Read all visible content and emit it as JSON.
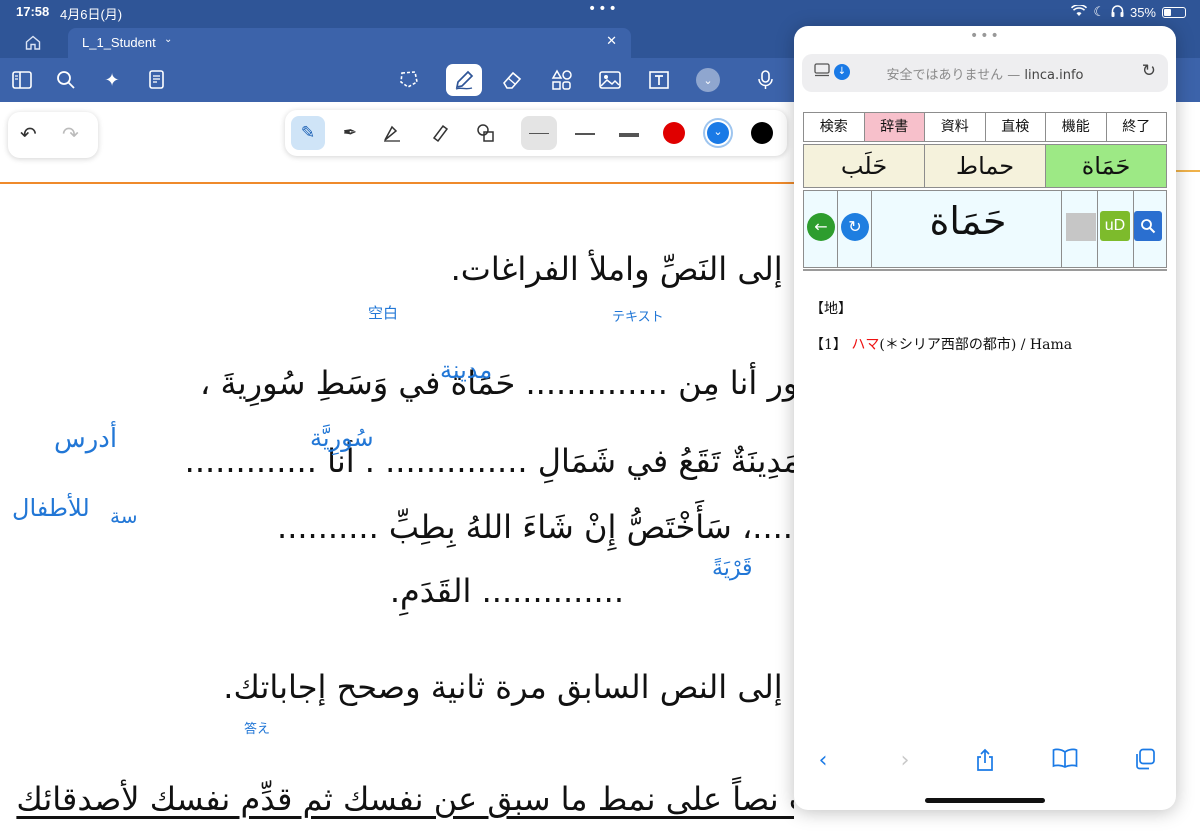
{
  "status": {
    "time": "17:58",
    "date": "4月6日(月)",
    "battery": "35%",
    "battery_level": 0.35,
    "center_dots": "•••",
    "wifi_icon": "wifi-icon",
    "moon_icon": "moon-icon",
    "headphones_icon": "headphones-icon"
  },
  "tabs": {
    "home_icon": "⌂",
    "active_tab": "L_1_Student",
    "tab_chevron": "⌄",
    "close": "✕"
  },
  "toolbar": {
    "icons": [
      "sidebar-icon",
      "search-icon",
      "sparkle-icon",
      "document-icon",
      "lasso-icon",
      "pen-icon",
      "eraser-icon",
      "shapes-icon",
      "image-icon",
      "textbox-icon",
      "more-chevron-icon",
      "microphone-icon"
    ]
  },
  "pen_options": {
    "colors": [
      "#e00000",
      "#1a7ae6",
      "#000000"
    ],
    "selected_color": "#1a7ae6"
  },
  "document": {
    "lines": [
      "ارجع إلى النَصِّ واملأ الفراغات.",
      "منصور أنا مِن .............. حَمَاة في وَسَطِ سُورِيةَ ،",
      "هي مَدِينَةٌ تَقَعُ في شَمَالِ .............. . أنا .............",
      "..........، سَأَخْتَصُّ إِنْ شَاءَ اللهُ بِطِبِّ ..........",
      ".............. القَدَمِ.",
      "ارجع إلى النص السابق مرة ثانية وصحح إجاباتك.",
      "اكتب نصاً على نمط ما سبق عن نفسك ثم قدِّم نفسك لأصدقائك"
    ],
    "annotations": {
      "kuuran": "空白",
      "text_kana": "テキスト",
      "madina": "مدينة",
      "suriya": "سُورِيَّة",
      "udrus": "أدرس",
      "atfal": "للأطفال",
      "qaryatan": "قَرْيَةً",
      "kotae": "答え",
      "partial": "سة"
    }
  },
  "browser": {
    "grabber": "•••",
    "reader_icon": "reader-icon",
    "security_note": "安全ではありません —",
    "domain": "linca.info",
    "reload_icon": "reload-icon",
    "menu": [
      "検索",
      "辞書",
      "資料",
      "直検",
      "機能",
      "終了"
    ],
    "menu_selected": "辞書",
    "candidates": [
      "حَلَب",
      "حماط",
      "حَمَاة"
    ],
    "candidate_selected": "حَمَاة",
    "headword": "حَمَاة",
    "ud_label": "uD",
    "category": "【地】",
    "definition_num": "【1】",
    "definition_red": "ハマ",
    "definition_rest": "(＊シリア西部の都市) / Hama",
    "bottom_icons": [
      "back-chevron-icon",
      "forward-chevron-icon",
      "share-icon",
      "bookmarks-icon",
      "tabs-icon"
    ]
  }
}
